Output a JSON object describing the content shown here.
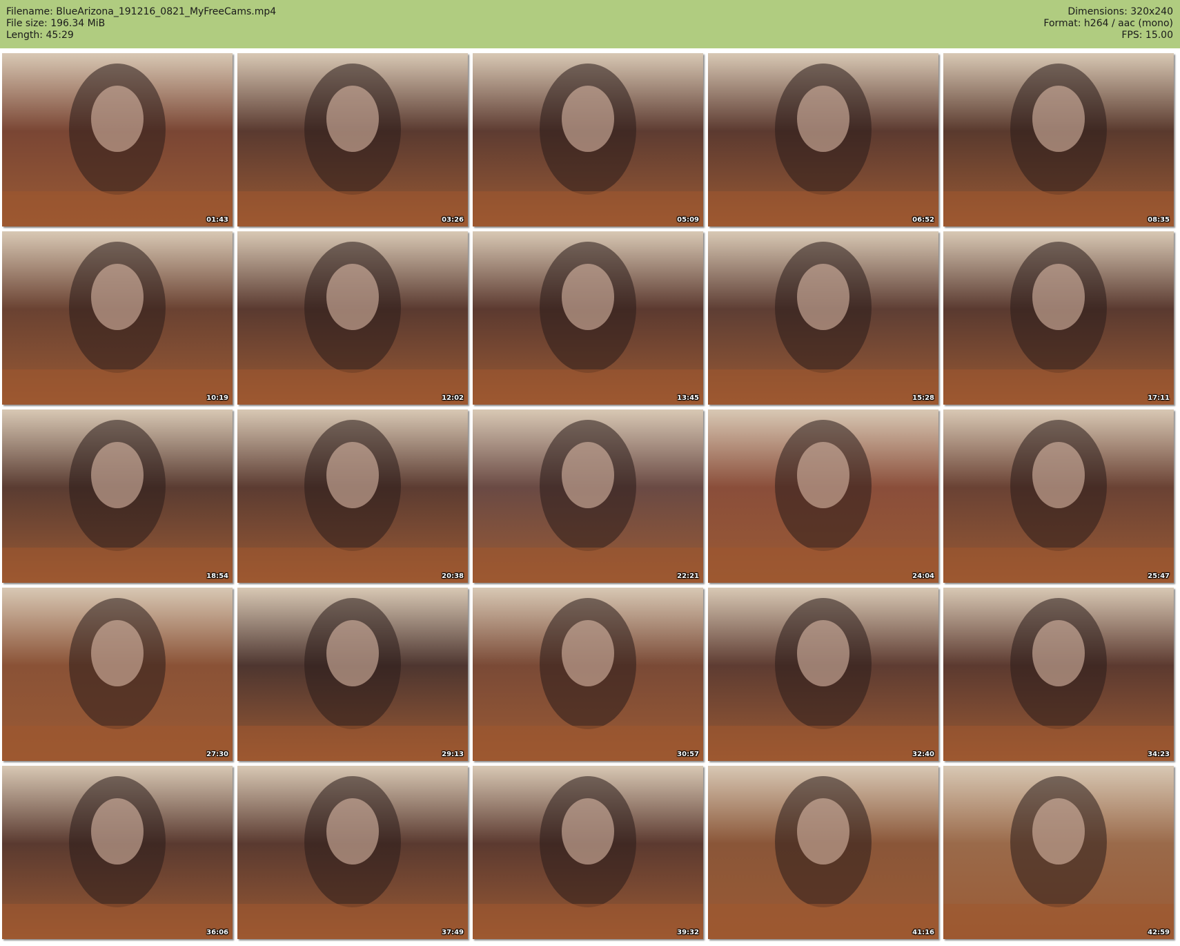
{
  "header": {
    "filename": "Filename: BlueArizona_191216_0821_MyFreeCams.mp4",
    "filesize": "File size: 196.34 MiB",
    "length": "Length: 45:29",
    "dimensions": "Dimensions: 320x240",
    "format": "Format: h264 / aac (mono)",
    "fps": "FPS: 15.00"
  },
  "thumbnails": [
    {
      "time": "01:43",
      "tone": "#7a4634"
    },
    {
      "time": "03:26",
      "tone": "#5a3a30"
    },
    {
      "time": "05:09",
      "tone": "#5e3c32"
    },
    {
      "time": "06:52",
      "tone": "#5c3a30"
    },
    {
      "time": "08:35",
      "tone": "#5a3a2e"
    },
    {
      "time": "10:19",
      "tone": "#6a4232"
    },
    {
      "time": "12:02",
      "tone": "#5a3a30"
    },
    {
      "time": "13:45",
      "tone": "#5c3a30"
    },
    {
      "time": "15:28",
      "tone": "#5e3e34"
    },
    {
      "time": "17:11",
      "tone": "#5a3a30"
    },
    {
      "time": "18:54",
      "tone": "#5a3c32"
    },
    {
      "time": "20:38",
      "tone": "#5c3c32"
    },
    {
      "time": "22:21",
      "tone": "#6a4a44"
    },
    {
      "time": "24:04",
      "tone": "#8a4e3a"
    },
    {
      "time": "25:47",
      "tone": "#6a4234"
    },
    {
      "time": "27:30",
      "tone": "#8a5236"
    },
    {
      "time": "29:13",
      "tone": "#4e3630"
    },
    {
      "time": "30:57",
      "tone": "#7a4a36"
    },
    {
      "time": "32:40",
      "tone": "#5e3c32"
    },
    {
      "time": "34:23",
      "tone": "#5c3a30"
    },
    {
      "time": "36:06",
      "tone": "#5a3a30"
    },
    {
      "time": "37:49",
      "tone": "#5a3a30"
    },
    {
      "time": "39:32",
      "tone": "#5c3a30"
    },
    {
      "time": "41:16",
      "tone": "#8a5638"
    },
    {
      "time": "42:59",
      "tone": "#9a6a4a"
    }
  ]
}
